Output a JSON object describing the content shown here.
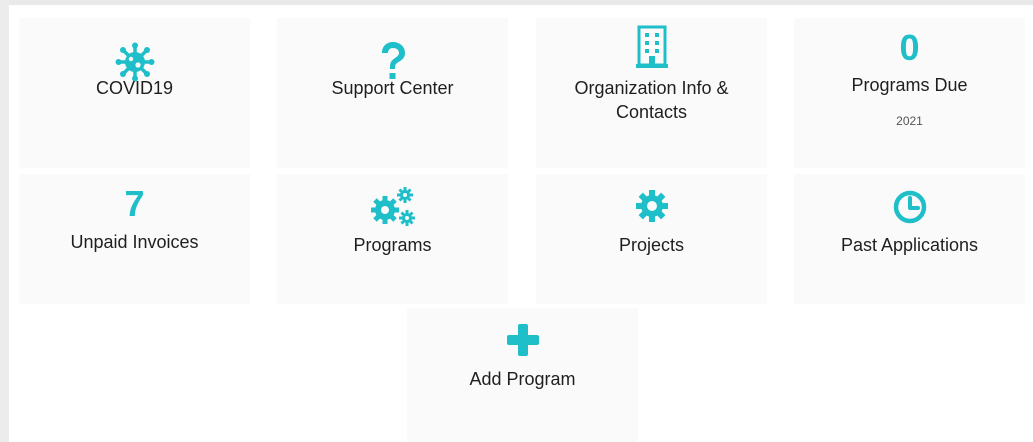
{
  "colors": {
    "accent": "#1ebfc9",
    "tile_bg": "#fafafa",
    "text": "#1f1f1f"
  },
  "tiles": {
    "covid": {
      "label": "COVID19",
      "icon": "virus-icon"
    },
    "support": {
      "label": "Support Center",
      "icon": "question-icon"
    },
    "org": {
      "label_line1": "Organization Info &",
      "label_line2": "Contacts",
      "icon": "building-icon"
    },
    "programs_due": {
      "count": "0",
      "label": "Programs Due",
      "year": "2021"
    },
    "unpaid": {
      "count": "7",
      "label": "Unpaid Invoices"
    },
    "programs": {
      "label": "Programs",
      "icon": "gears-icon"
    },
    "projects": {
      "label": "Projects",
      "icon": "gear-icon"
    },
    "past_apps": {
      "label": "Past Applications",
      "icon": "clock-icon"
    },
    "add_program": {
      "label": "Add Program",
      "icon": "plus-icon"
    }
  }
}
